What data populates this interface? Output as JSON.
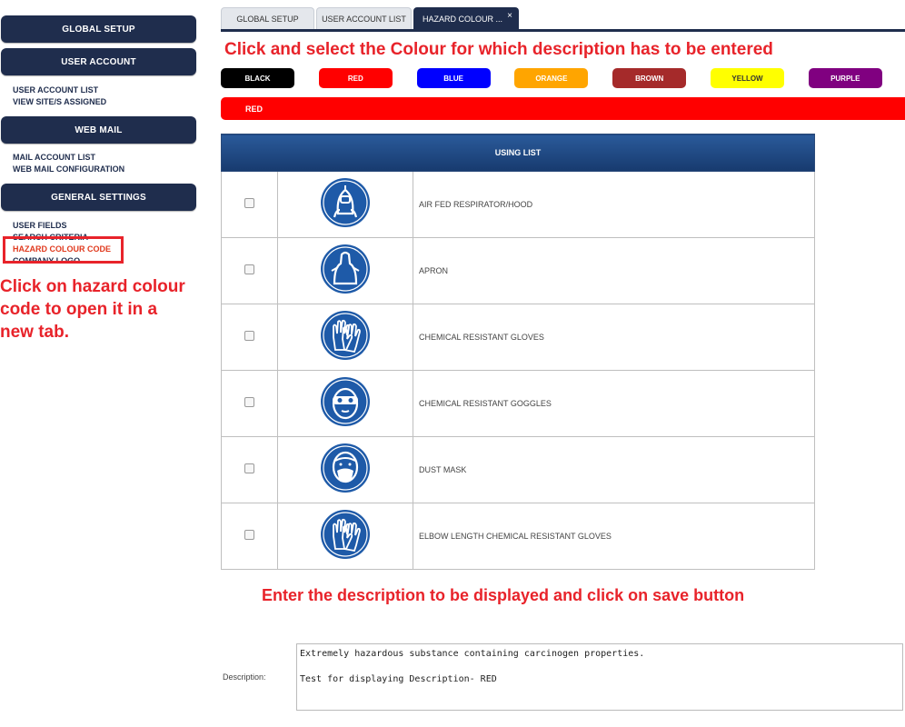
{
  "sidebar": {
    "sections": [
      {
        "label": "GLOBAL SETUP"
      },
      {
        "label": "USER ACCOUNT"
      },
      {
        "label": "WEB MAIL"
      },
      {
        "label": "GENERAL SETTINGS"
      }
    ],
    "user_account_links": [
      "USER ACCOUNT LIST",
      "VIEW SITE/S ASSIGNED"
    ],
    "web_mail_links": [
      "MAIL ACCOUNT LIST",
      "WEB MAIL CONFIGURATION"
    ],
    "general_settings_links": [
      "USER FIELDS",
      "SEARCH CRITERIA",
      "HAZARD COLOUR CODE",
      "COMPANY LOGO"
    ]
  },
  "annotations": {
    "sidebar_note": [
      "Click on hazard colour",
      "code to open it in a",
      "new tab."
    ],
    "colour_note": "Click and select the Colour for which description has to be entered",
    "save_note": "Enter the description to be displayed and click on save button"
  },
  "tabs": [
    {
      "label": "GLOBAL SETUP"
    },
    {
      "label": "USER ACCOUNT LIST"
    },
    {
      "label": "HAZARD COLOUR ...",
      "close": "×"
    }
  ],
  "colours": [
    {
      "label": "BLACK",
      "bg": "#000000",
      "fg": "#ffffff"
    },
    {
      "label": "RED",
      "bg": "#ff0000",
      "fg": "#ffffff"
    },
    {
      "label": "BLUE",
      "bg": "#0000ff",
      "fg": "#ffffff"
    },
    {
      "label": "ORANGE",
      "bg": "#ffa500",
      "fg": "#ffffff"
    },
    {
      "label": "BROWN",
      "bg": "#a52a2a",
      "fg": "#ffffff"
    },
    {
      "label": "YELLOW",
      "bg": "#ffff00",
      "fg": "#333333"
    },
    {
      "label": "PURPLE",
      "bg": "#800080",
      "fg": "#ffffff"
    }
  ],
  "selected_colour": "RED",
  "table": {
    "header": "USING LIST",
    "rows": [
      {
        "label": "AIR FED RESPIRATOR/HOOD",
        "icon": "air-fed-respirator-icon"
      },
      {
        "label": "APRON",
        "icon": "apron-icon"
      },
      {
        "label": "CHEMICAL RESISTANT GLOVES",
        "icon": "gloves-icon"
      },
      {
        "label": "CHEMICAL RESISTANT GOGGLES",
        "icon": "goggles-icon"
      },
      {
        "label": "DUST MASK",
        "icon": "dust-mask-icon"
      },
      {
        "label": "ELBOW LENGTH CHEMICAL RESISTANT GLOVES",
        "icon": "gloves-icon"
      }
    ]
  },
  "description": {
    "label": "Description:",
    "value": "Extremely hazardous substance containing carcinogen properties.\n\nTest for displaying Description- RED"
  },
  "colors": {
    "navy": "#1f2d4d",
    "annotation_red": "#e8232a",
    "icon_blue": "#1e5aa8"
  }
}
